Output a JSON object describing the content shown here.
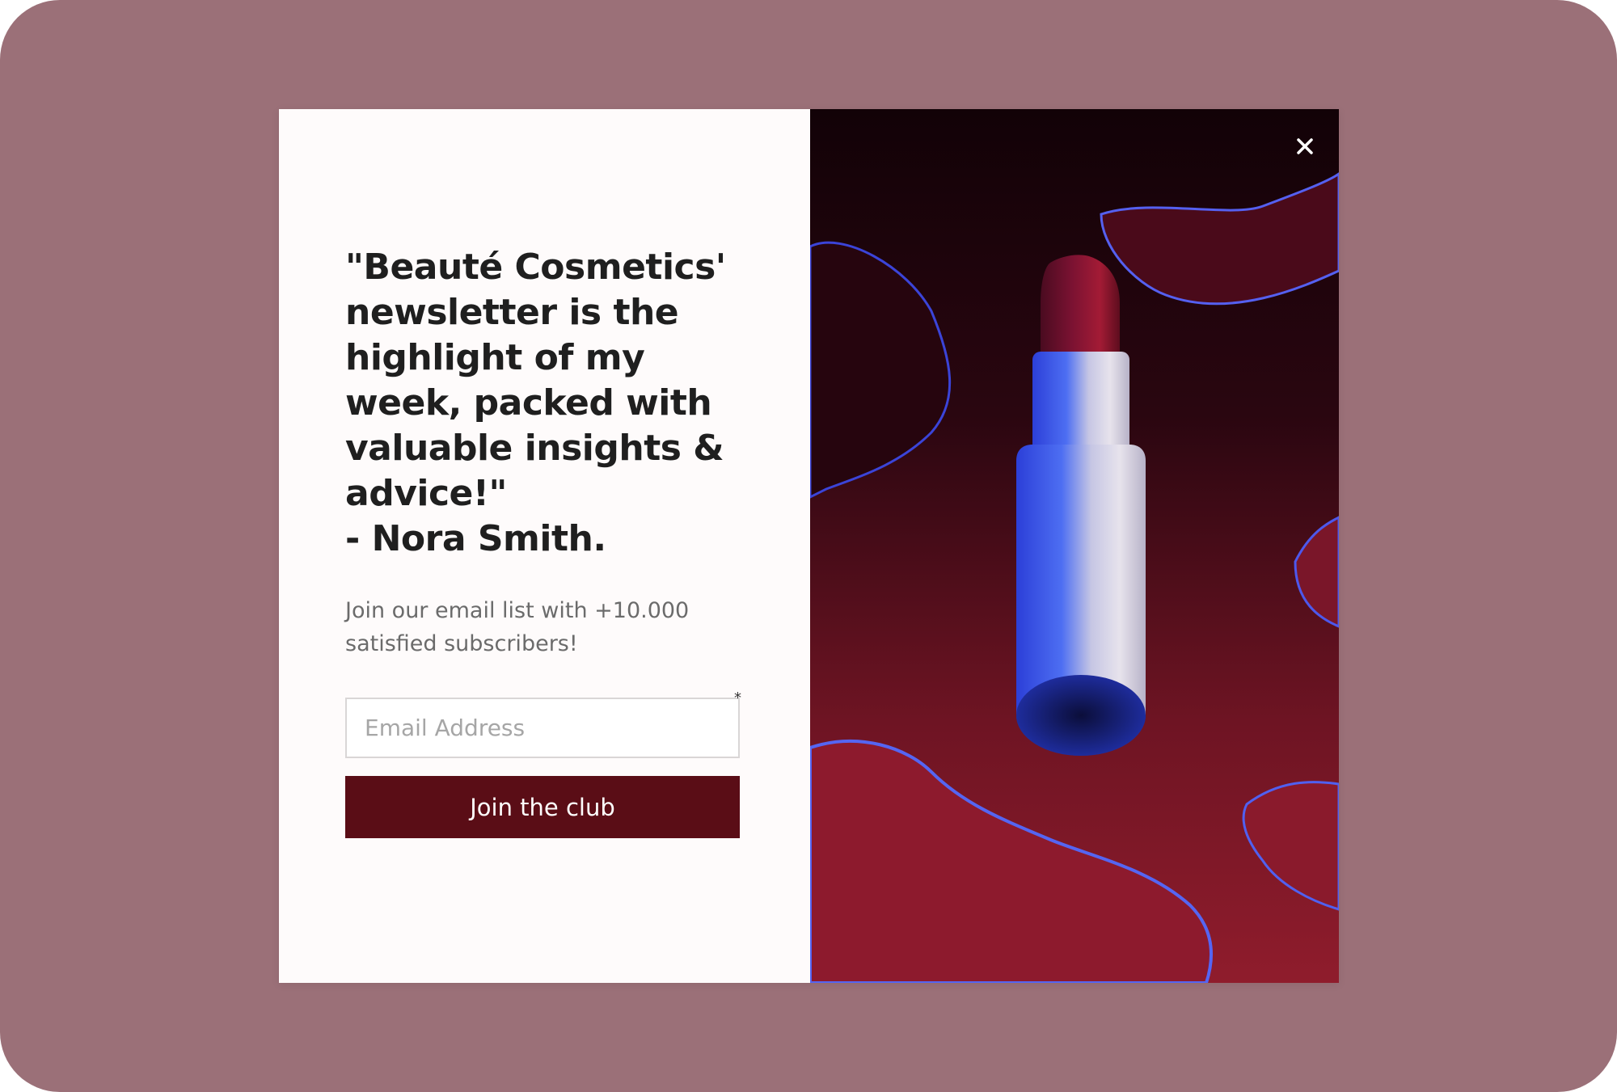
{
  "popup": {
    "headline": "\"Beauté Cosmetics'\nnewsletter is the\nhighlight of my\nweek, packed with\nvaluable insights &\nadvice!\"\n- Nora Smith.",
    "subtitle": "Join our email list with +10.000 satisfied subscribers!",
    "email_placeholder": "Email Address",
    "email_value": "",
    "required_mark": "*",
    "button_label": "Join the club",
    "close_icon": "close-icon",
    "image": "lipstick-product-photo"
  },
  "colors": {
    "backdrop": "#9b7078",
    "panel_background": "#fefbfb",
    "button_background": "#5a0d16",
    "button_text": "#ffffff",
    "headline_text": "#1f1f1f",
    "subtitle_text": "#6b6b6b"
  }
}
